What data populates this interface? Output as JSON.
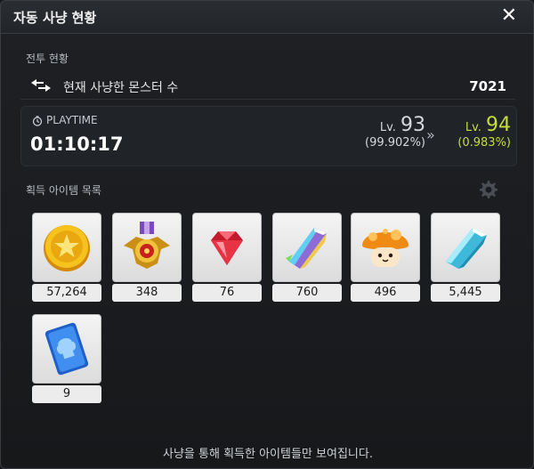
{
  "window": {
    "title": "자동 사냥 현황",
    "close_label": "✕"
  },
  "combat": {
    "section_label": "전투 현황",
    "kills_label": "현재 사냥한 몬스터 수",
    "kills_value": "7021"
  },
  "playtime": {
    "label": "PLAYTIME",
    "value": "01:10:17"
  },
  "level": {
    "prefix": "Lv.",
    "current": "93",
    "current_pct": "(99.902%)",
    "next": "94",
    "next_pct": "(0.983%)",
    "arrow": "»"
  },
  "items_section": {
    "label": "획득 아이템 목록"
  },
  "items": [
    {
      "icon": "gold-coin-icon",
      "count": "57,264"
    },
    {
      "icon": "medal-icon",
      "count": "348"
    },
    {
      "icon": "red-gem-icon",
      "count": "76"
    },
    {
      "icon": "rainbow-crystal-icon",
      "count": "760"
    },
    {
      "icon": "orange-mushroom-icon",
      "count": "496"
    },
    {
      "icon": "blue-crystal-icon",
      "count": "5,445"
    },
    {
      "icon": "blue-card-icon",
      "count": "9"
    }
  ],
  "footer": {
    "note": "사냥을 통해 획득한 아이템들만 보여집니다."
  },
  "colors": {
    "level_up": "#c7dd3c",
    "panel": "#202327",
    "background": "#1a1c1f"
  }
}
